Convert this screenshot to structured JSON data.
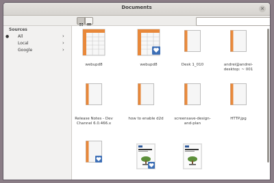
{
  "window": {
    "title": "Documents"
  },
  "toolbar": {
    "search": {
      "placeholder": ""
    }
  },
  "sidebar": {
    "heading": "Sources",
    "items": [
      {
        "label": "All",
        "selected": true
      },
      {
        "label": "Local",
        "selected": false
      },
      {
        "label": "Google",
        "selected": false
      }
    ]
  },
  "files": [
    {
      "name": "webupd8",
      "type": "spreadsheet",
      "badge": false
    },
    {
      "name": "webupd8",
      "type": "spreadsheet",
      "badge": true
    },
    {
      "name": "Desk 1_010",
      "type": "document",
      "badge": false
    },
    {
      "name": "andrei@andrei-desktop: ~ 001",
      "type": "document",
      "badge": false
    },
    {
      "name": "Release Notes - Dev Channel 6.0.466.x",
      "type": "document",
      "badge": false
    },
    {
      "name": "how to enable d2d",
      "type": "document",
      "badge": false
    },
    {
      "name": "screensave-design-and-plan",
      "type": "document",
      "badge": false
    },
    {
      "name": "HTTP.jpg",
      "type": "document",
      "badge": false
    },
    {
      "name": "",
      "type": "document",
      "badge": true
    },
    {
      "name": "",
      "type": "book",
      "badge": true
    },
    {
      "name": "",
      "type": "book",
      "badge": false
    }
  ],
  "colors": {
    "accent_orange": "#e8883a",
    "badge_blue": "#3d6fb6",
    "sidebar_bg": "#f2f1f0"
  }
}
